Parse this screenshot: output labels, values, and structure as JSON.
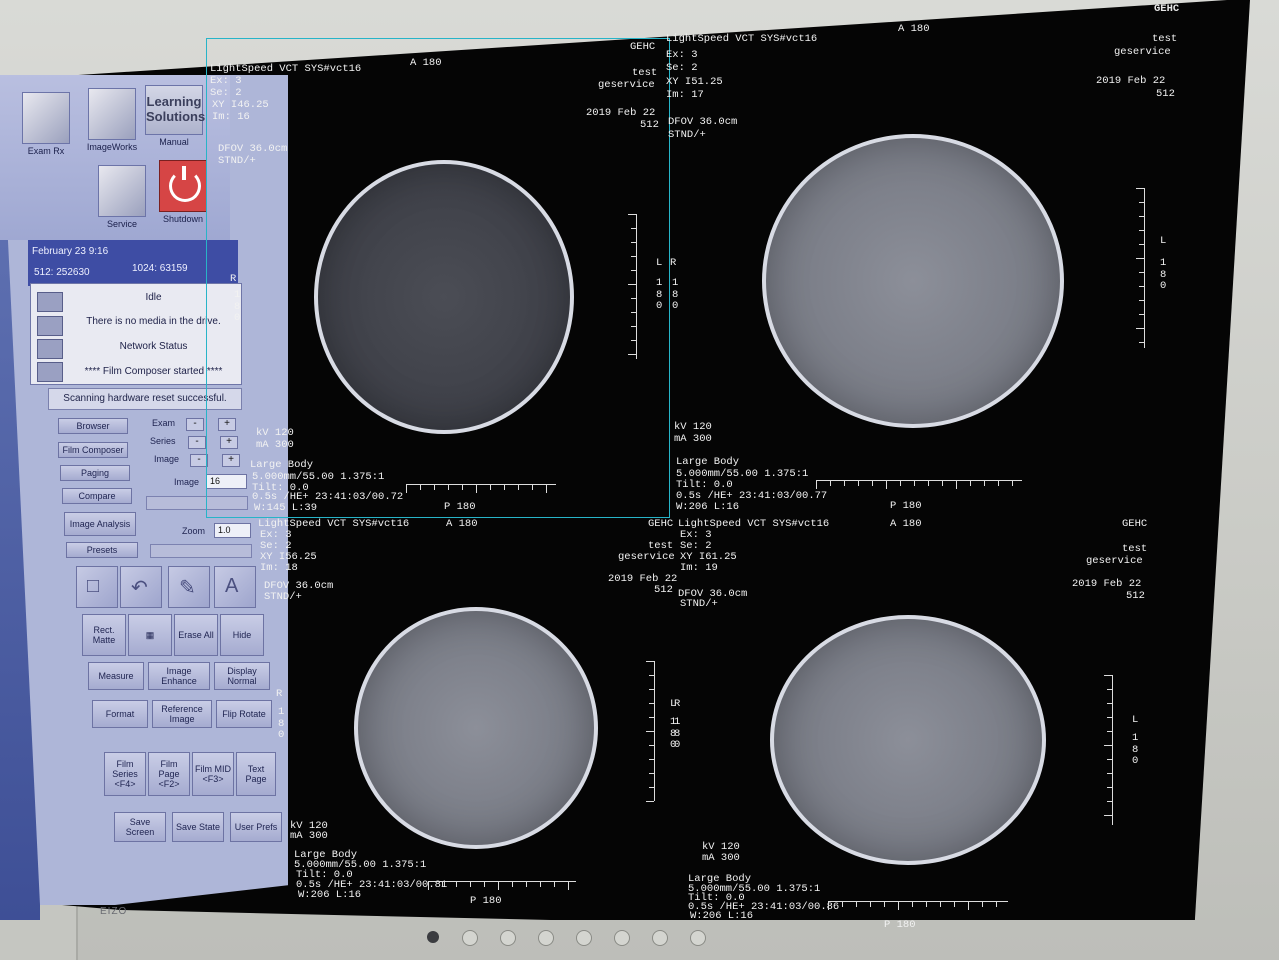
{
  "apps": {
    "exam_rx": "Exam Rx",
    "imageworks": "ImageWorks",
    "learning_tile": "Learning Solutions",
    "manual": "Manual",
    "service": "Service",
    "shutdown": "Shutdown"
  },
  "status": {
    "datetime": "February 23 9:16",
    "mem512": "512:  252630",
    "mem1024": "1024:  63159"
  },
  "messages": {
    "idle": "Idle",
    "media": "There is no media in the drive.",
    "network": "Network Status",
    "film": "**** Film Composer started ****",
    "reset": "Scanning hardware reset successful."
  },
  "controls": {
    "browser": "Browser",
    "film_composer": "Film Composer",
    "paging": "Paging",
    "compare": "Compare",
    "image_analysis": "Image Analysis",
    "presets": "Presets",
    "exam": "Exam",
    "series": "Series",
    "image": "Image",
    "image2": "Image",
    "image_value": "16",
    "zoom": "Zoom",
    "zoom_value": "1.0",
    "minus": "-",
    "plus": "+",
    "rect_matte": "Rect. Matte",
    "erase_all": "Erase All",
    "hide": "Hide",
    "measure": "Measure",
    "image_enhance": "Image Enhance",
    "display_normal": "Display Normal",
    "format": "Format",
    "reference_image": "Reference Image",
    "flip_rotate": "Flip Rotate",
    "film_series": "Film Series <F4>",
    "film_page": "Film Page <F2>",
    "film_mid": "Film MID <F3>",
    "text_page": "Text Page",
    "save_screen": "Save Screen",
    "save_state": "Save State",
    "user_prefs": "User Prefs"
  },
  "corner": {
    "gehc": "GEHC",
    "test": "test",
    "geservice": "geservice",
    "date": "2019 Feb 22",
    "matrix": "512"
  },
  "viewports": [
    {
      "header": "LightSpeed VCT SYS#vct16",
      "a": "A 180",
      "gehc": "GEHC",
      "ex": "Ex: 3",
      "se": "Se: 2",
      "xy": "XY I46.25",
      "im": "Im: 16",
      "test": "test",
      "geservice": "geservice",
      "date": "2019 Feb 22",
      "matrix": "512",
      "dfov": "DFOV 36.0cm",
      "stnd": "STND/+",
      "kv": "kV 120",
      "ma": "mA 300",
      "body": "Large Body",
      "thick": "5.000mm/55.00 1.375:1",
      "tilt": "Tilt: 0.0",
      "time": "0.5s /HE+ 23:41:03/00.72",
      "wl": "W:145 L:39",
      "p": "P 180",
      "r": "R",
      "l": "L",
      "r_num": "1 8 0",
      "l_num": "1 8 0"
    },
    {
      "header": "LightSpeed VCT SYS#vct16",
      "a": "A 180",
      "gehc": "GEHC",
      "ex": "Ex: 3",
      "se": "Se: 2",
      "xy": "XY I51.25",
      "im": "Im: 17",
      "test": "test",
      "geservice": "geservice",
      "date": "2019 Feb 22",
      "matrix": "512",
      "dfov": "DFOV 36.0cm",
      "stnd": "STND/+",
      "kv": "kV 120",
      "ma": "mA 300",
      "body": "Large Body",
      "thick": "5.000mm/55.00 1.375:1",
      "tilt": "Tilt: 0.0",
      "time": "0.5s /HE+ 23:41:03/00.77",
      "wl": "W:206 L:16",
      "p": "P 180",
      "r": "R",
      "l": "L",
      "r_num": "1 8 0",
      "l_num": "1 8 0"
    },
    {
      "header": "LightSpeed VCT SYS#vct16",
      "a": "A 180",
      "gehc": "GEHC",
      "ex": "Ex: 3",
      "se": "Se: 2",
      "xy": "XY I56.25",
      "im": "Im: 18",
      "test": "test",
      "geservice": "geservice",
      "date": "2019 Feb 22",
      "matrix": "512",
      "dfov": "DFOV 36.0cm",
      "stnd": "STND/+",
      "kv": "kV 120",
      "ma": "mA 300",
      "body": "Large Body",
      "thick": "5.000mm/55.00 1.375:1",
      "tilt": "Tilt: 0.0",
      "time": "0.5s /HE+ 23:41:03/00.81",
      "wl": "W:206 L:16",
      "p": "P 180",
      "r": "R",
      "l": "L",
      "r_num": "1 8 0",
      "l_num": "1 8 0"
    },
    {
      "header": "LightSpeed VCT SYS#vct16",
      "a": "A 180",
      "gehc": "GEHC",
      "ex": "Ex: 3",
      "se": "Se: 2",
      "xy": "XY I61.25",
      "im": "Im: 19",
      "test": "test",
      "geservice": "geservice",
      "date": "2019 Feb 22",
      "matrix": "512",
      "dfov": "DFOV 36.0cm",
      "stnd": "STND/+",
      "kv": "kV 120",
      "ma": "mA 300",
      "body": "Large Body",
      "thick": "5.000mm/55.00 1.375:1",
      "tilt": "Tilt: 0.0",
      "time": "0.5s /HE+ 23:41:03/00.86",
      "wl": "W:206 L:16",
      "p": "P 180",
      "r": "R",
      "l": "L",
      "r_num": "1 8 0",
      "l_num": "1 8 0"
    }
  ],
  "brand": "EIZO"
}
